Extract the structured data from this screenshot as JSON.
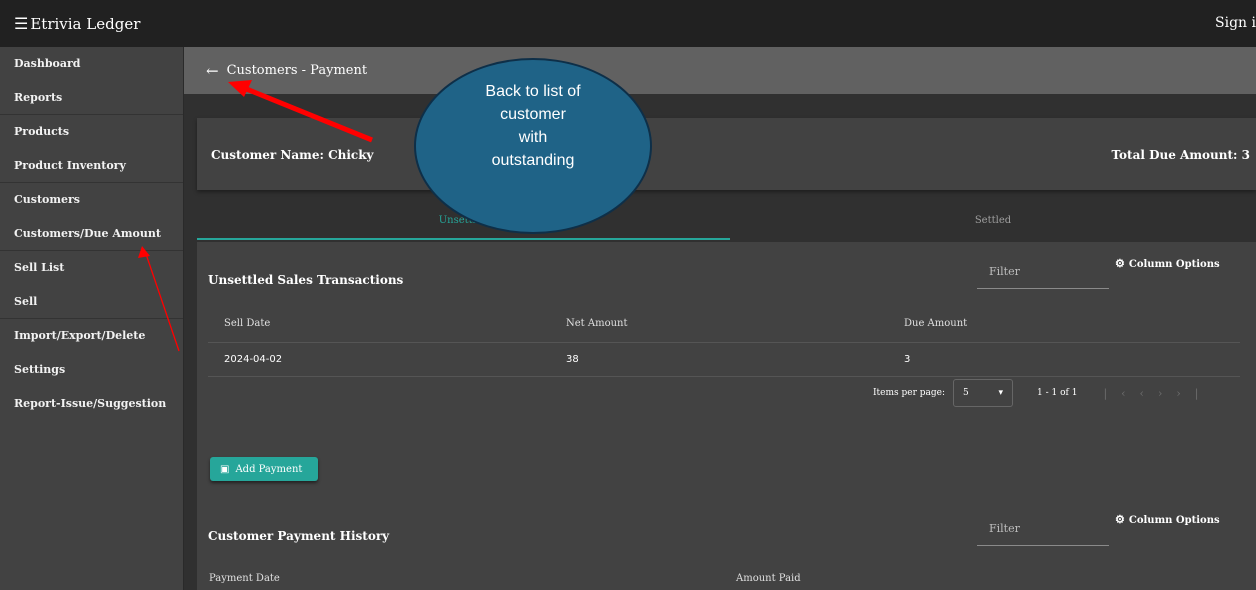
{
  "app": {
    "brand": "Etrivia Ledger",
    "sign_in": "Sign i"
  },
  "sidebar": {
    "items": [
      {
        "label": "Dashboard"
      },
      {
        "label": "Reports"
      },
      {
        "label": "Products"
      },
      {
        "label": "Product Inventory"
      },
      {
        "label": "Customers"
      },
      {
        "label": "Customers/Due Amount"
      },
      {
        "label": "Sell List"
      },
      {
        "label": "Sell"
      },
      {
        "label": "Import/Export/Delete"
      },
      {
        "label": "Settings"
      },
      {
        "label": "Report-Issue/Suggestion"
      }
    ]
  },
  "subbar": {
    "title": "Customers - Payment"
  },
  "customer": {
    "name_label": "Customer Name: Chicky",
    "total_due_label": "Total Due Amount: 3"
  },
  "tabs": [
    {
      "label": "Unsettled"
    },
    {
      "label": "Settled"
    }
  ],
  "unsettled": {
    "title": "Unsettled Sales Transactions",
    "filter_placeholder": "Filter",
    "column_options": "Column Options",
    "headers": [
      "Sell Date",
      "Net Amount",
      "Due Amount"
    ],
    "rows": [
      {
        "sell_date": "2024-04-02",
        "net_amount": "38",
        "due_amount": "3"
      }
    ],
    "pager": {
      "items_per_page_label": "Items per page:",
      "page_size": "5",
      "range": "1 - 1 of 1"
    }
  },
  "add_payment": {
    "label": "Add Payment"
  },
  "history": {
    "title": "Customer Payment History",
    "filter_placeholder": "Filter",
    "column_options": "Column Options",
    "headers": [
      "Payment Date",
      "Amount Paid"
    ]
  },
  "annotation": {
    "line1": "Back to list of",
    "line2": "customer",
    "line3": "with",
    "line4": "outstanding"
  },
  "colors": {
    "accent": "#26a69a",
    "arrow": "#ff0000",
    "callout": "#1f6387"
  },
  "icons": {
    "menu": "menu-icon",
    "back": "arrow-left-icon",
    "gear": "gear-icon",
    "wallet": "wallet-icon",
    "dropdown": "caret-down-icon"
  }
}
